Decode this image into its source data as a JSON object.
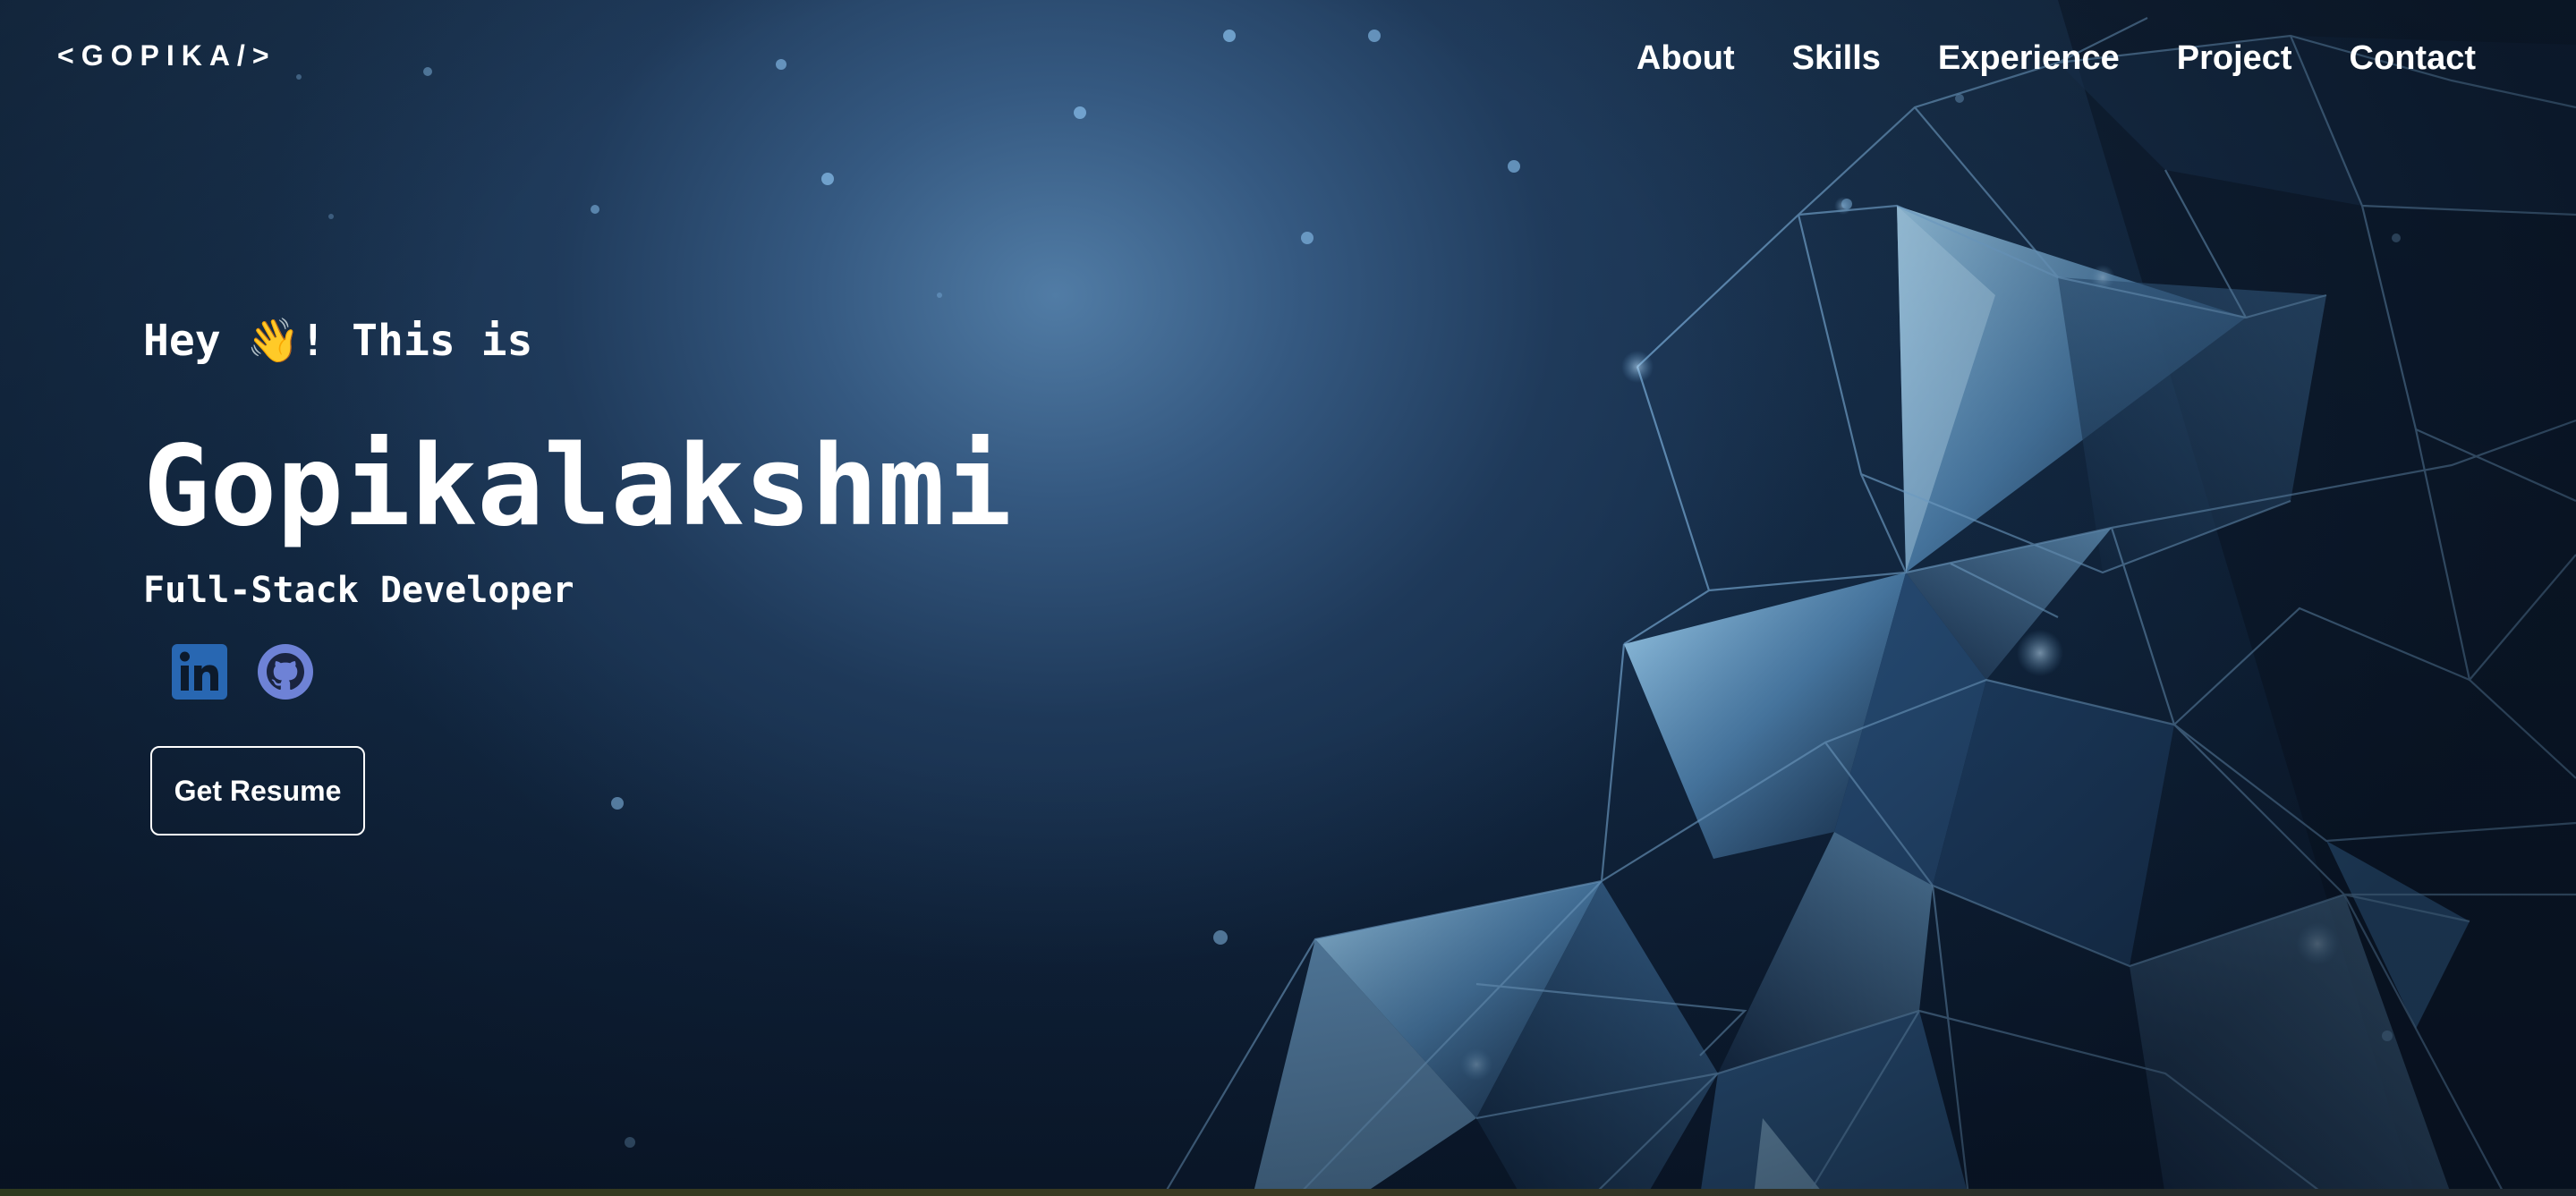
{
  "brand": {
    "logo_text": "<GOPIKA/>"
  },
  "nav": {
    "items": [
      {
        "label": "About"
      },
      {
        "label": "Skills"
      },
      {
        "label": "Experience"
      },
      {
        "label": "Project"
      },
      {
        "label": "Contact"
      }
    ]
  },
  "hero": {
    "greeting": "Hey 👋! This is",
    "name": "Gopikalakshmi",
    "role": "Full-Stack Developer",
    "resume_label": "Get Resume"
  },
  "socials": [
    {
      "name": "linkedin",
      "icon": "linkedin-icon",
      "label": "in",
      "color": "#2867b2"
    },
    {
      "name": "github",
      "icon": "github-icon",
      "color": "#6e82d6"
    }
  ],
  "colors": {
    "background_dark": "#0d1a2b",
    "background_glow": "#4f7aa6",
    "crystal_light": "#8fc3ea",
    "text": "#ffffff"
  }
}
